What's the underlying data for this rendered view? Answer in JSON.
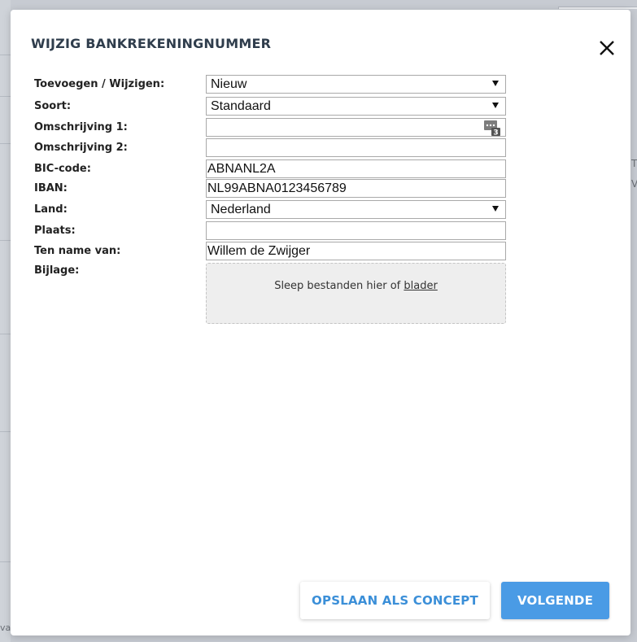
{
  "dialog": {
    "title": "WIJZIG BANKREKENINGNUMMER"
  },
  "form": {
    "toevoegen": {
      "label": "Toevoegen / Wijzigen:",
      "value": "Nieuw"
    },
    "soort": {
      "label": "Soort:",
      "value": "Standaard"
    },
    "omschrijving1": {
      "label": "Omschrijving 1:",
      "value": "",
      "counter_icon": "text-counter-icon",
      "counter": "3"
    },
    "omschrijving2": {
      "label": "Omschrijving 2:",
      "value": ""
    },
    "bic": {
      "label": "BIC-code:",
      "value": "ABNANL2A"
    },
    "iban": {
      "label": "IBAN:",
      "value": "NL99ABNA0123456789"
    },
    "land": {
      "label": "Land:",
      "value": "Nederland"
    },
    "plaats": {
      "label": "Plaats:",
      "value": ""
    },
    "tennamevan": {
      "label": "Ten name van:",
      "value": "Willem de Zwijger"
    },
    "bijlage": {
      "label": "Bijlage:",
      "dropzone_text": "Sleep bestanden hier of ",
      "dropzone_link": "blader"
    }
  },
  "buttons": {
    "save_concept": "OPSLAAN ALS CONCEPT",
    "next": "VOLGENDE"
  },
  "background": {
    "right_letters": [
      "T",
      "V"
    ],
    "bottom_text": "va"
  },
  "colors": {
    "primary": "#4a9be5",
    "title": "#2f3d4c",
    "overlay": "#c7cbd2"
  }
}
